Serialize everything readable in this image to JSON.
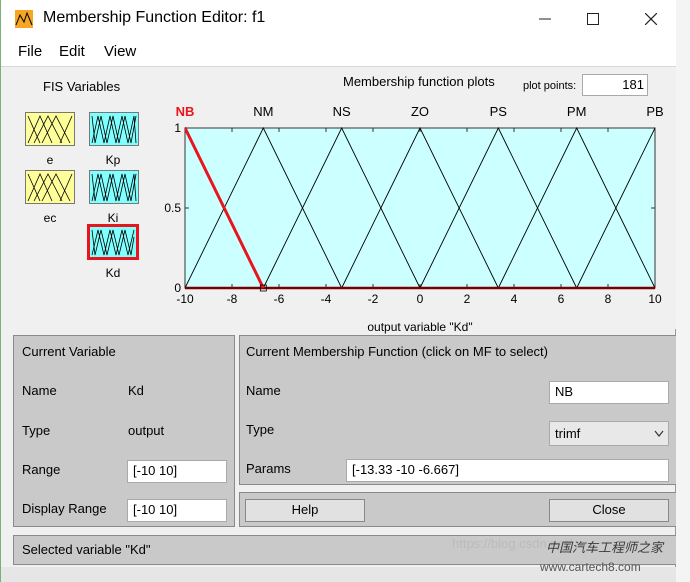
{
  "window": {
    "title": "Membership Function Editor: f1"
  },
  "menu": [
    "File",
    "Edit",
    "View"
  ],
  "fis_variables": {
    "title": "FIS Variables",
    "inputs": [
      {
        "name": "e"
      },
      {
        "name": "ec"
      }
    ],
    "outputs": [
      {
        "name": "Kp"
      },
      {
        "name": "Ki"
      },
      {
        "name": "Kd",
        "selected": true
      }
    ]
  },
  "plot": {
    "title": "Membership function plots",
    "plot_points_label": "plot points:",
    "plot_points": "181"
  },
  "chart_data": {
    "type": "line",
    "xlabel": "output variable \"Kd\"",
    "xlim": [
      -10,
      10
    ],
    "ylim": [
      0,
      1
    ],
    "xticks": [
      -10,
      -8,
      -6,
      -4,
      -2,
      0,
      2,
      4,
      6,
      8,
      10
    ],
    "yticks": [
      0,
      0.5,
      1
    ],
    "ytick_labels": [
      "0",
      "0.5",
      "1"
    ],
    "series": [
      {
        "name": "NB",
        "params": [
          -13.33,
          -10,
          -6.667
        ],
        "selected": true
      },
      {
        "name": "NM",
        "params": [
          -10,
          -6.667,
          -3.333
        ]
      },
      {
        "name": "NS",
        "params": [
          -6.667,
          -3.333,
          0
        ]
      },
      {
        "name": "ZO",
        "params": [
          -3.333,
          0,
          3.333
        ]
      },
      {
        "name": "PS",
        "params": [
          0,
          3.333,
          6.667
        ]
      },
      {
        "name": "PM",
        "params": [
          3.333,
          6.667,
          10
        ]
      },
      {
        "name": "PB",
        "params": [
          6.667,
          10,
          13.33
        ]
      }
    ],
    "label_x": [
      -10,
      -6.667,
      -3.333,
      0,
      3.333,
      6.667,
      10
    ],
    "colors": {
      "background": "#ccffff",
      "selected": "#e8141e",
      "line": "#000000",
      "baseline": "#7a0000"
    }
  },
  "current_variable": {
    "title": "Current Variable",
    "name_label": "Name",
    "name": "Kd",
    "type_label": "Type",
    "type": "output",
    "range_label": "Range",
    "range": "[-10 10]",
    "display_range_label": "Display Range",
    "display_range": "[-10 10]"
  },
  "current_mf": {
    "title": "Current Membership Function (click on MF to select)",
    "name_label": "Name",
    "name": "NB",
    "type_label": "Type",
    "type": "trimf",
    "params_label": "Params",
    "params": "[-13.33 -10 -6.667]"
  },
  "buttons": {
    "help": "Help",
    "close": "Close"
  },
  "status": "Selected variable \"Kd\"",
  "watermark": {
    "text": "https://blog.csdn.net/",
    "logo": "中国汽车工程师之家",
    "site": "www.cartech8.com"
  }
}
